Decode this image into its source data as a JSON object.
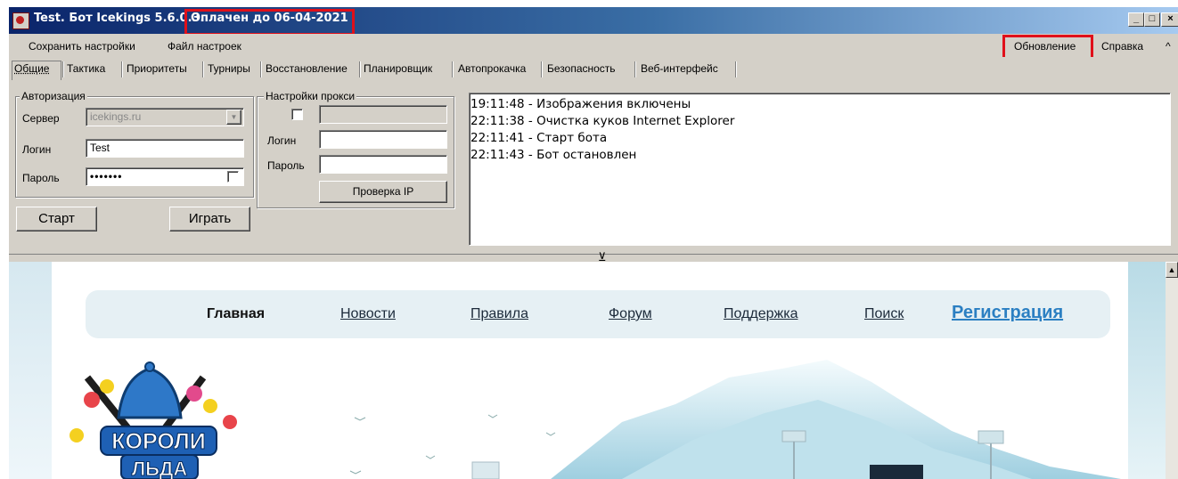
{
  "window": {
    "title": "Test. Бот Icekings 5.6.0.3.",
    "paid_status": "Оплачен до 06-04-2021",
    "controls": [
      "_",
      "□",
      "×"
    ]
  },
  "menu": {
    "left": [
      "Сохранить настройки",
      "Файл настроек"
    ],
    "right": [
      "Обновление",
      "Справка",
      "^"
    ]
  },
  "tabs": [
    "Общие",
    "Тактика",
    "Приоритеты",
    "Турниры",
    "Восстановление",
    "Планировщик",
    "Автопрокачка",
    "Безопасность",
    "Веб-интерфейс"
  ],
  "auth": {
    "legend": "Авторизация",
    "server_label": "Сервер",
    "server_value": "icekings.ru",
    "login_label": "Логин",
    "login_value": "Test",
    "password_label": "Пароль",
    "password_value": "•••••••"
  },
  "proxy": {
    "legend": "Настройки прокси",
    "login_label": "Логин",
    "password_label": "Пароль",
    "check_ip_button": "Проверка IP"
  },
  "buttons": {
    "start": "Старт",
    "play": "Играть"
  },
  "log": [
    "19:11:48 - Изображения включены",
    "22:11:38 - Очистка куков Internet Explorer",
    "22:11:41 - Старт бота",
    "22:11:43 - Бот остановлен"
  ],
  "site_nav": [
    "Главная",
    "Новости",
    "Правила",
    "Форум",
    "Поддержка",
    "Поиск",
    "Регистрация"
  ],
  "logo": {
    "line1": "КОРОЛИ",
    "line2": "ЛЬДА"
  }
}
